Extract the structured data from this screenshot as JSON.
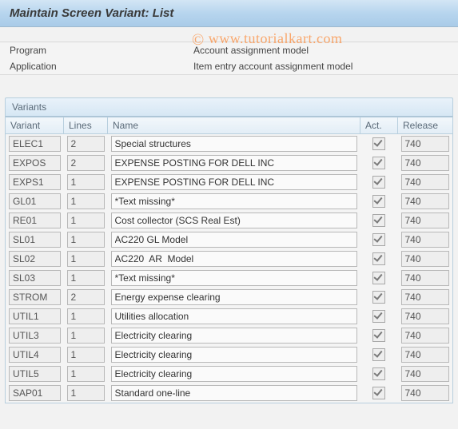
{
  "header": {
    "title": "Maintain Screen Variant: List"
  },
  "info": {
    "program_label": "Program",
    "program_value": "Account assignment model",
    "application_label": "Application",
    "application_value": "Item entry account assignment model"
  },
  "watermark": {
    "text": "www.tutorialkart.com",
    "symbol": "©"
  },
  "section": {
    "title": "Variants",
    "columns": {
      "variant": "Variant",
      "lines": "Lines",
      "name": "Name",
      "act": "Act.",
      "release": "Release"
    }
  },
  "rows": [
    {
      "variant": "ELEC1",
      "lines": "2",
      "name": "Special structures",
      "act": true,
      "release": "740"
    },
    {
      "variant": "EXPOS",
      "lines": "2",
      "name": "EXPENSE POSTING FOR DELL INC",
      "act": true,
      "release": "740"
    },
    {
      "variant": "EXPS1",
      "lines": "1",
      "name": "EXPENSE POSTING FOR DELL INC",
      "act": true,
      "release": "740"
    },
    {
      "variant": "GL01",
      "lines": "1",
      "name": "*Text missing*",
      "act": true,
      "release": "740"
    },
    {
      "variant": "RE01",
      "lines": "1",
      "name": "Cost collector (SCS Real Est)",
      "act": true,
      "release": "740"
    },
    {
      "variant": "SL01",
      "lines": "1",
      "name": "AC220 GL Model",
      "act": true,
      "release": "740"
    },
    {
      "variant": "SL02",
      "lines": "1",
      "name": "AC220  AR  Model",
      "act": true,
      "release": "740"
    },
    {
      "variant": "SL03",
      "lines": "1",
      "name": "*Text missing*",
      "act": true,
      "release": "740"
    },
    {
      "variant": "STROM",
      "lines": "2",
      "name": "Energy expense clearing",
      "act": true,
      "release": "740"
    },
    {
      "variant": "UTIL1",
      "lines": "1",
      "name": "Utilities allocation",
      "act": true,
      "release": "740"
    },
    {
      "variant": "UTIL3",
      "lines": "1",
      "name": "Electricity clearing",
      "act": true,
      "release": "740"
    },
    {
      "variant": "UTIL4",
      "lines": "1",
      "name": "Electricity clearing",
      "act": true,
      "release": "740"
    },
    {
      "variant": "UTIL5",
      "lines": "1",
      "name": "Electricity clearing",
      "act": true,
      "release": "740"
    },
    {
      "variant": "SAP01",
      "lines": "1",
      "name": "Standard one-line",
      "act": true,
      "release": "740"
    }
  ]
}
